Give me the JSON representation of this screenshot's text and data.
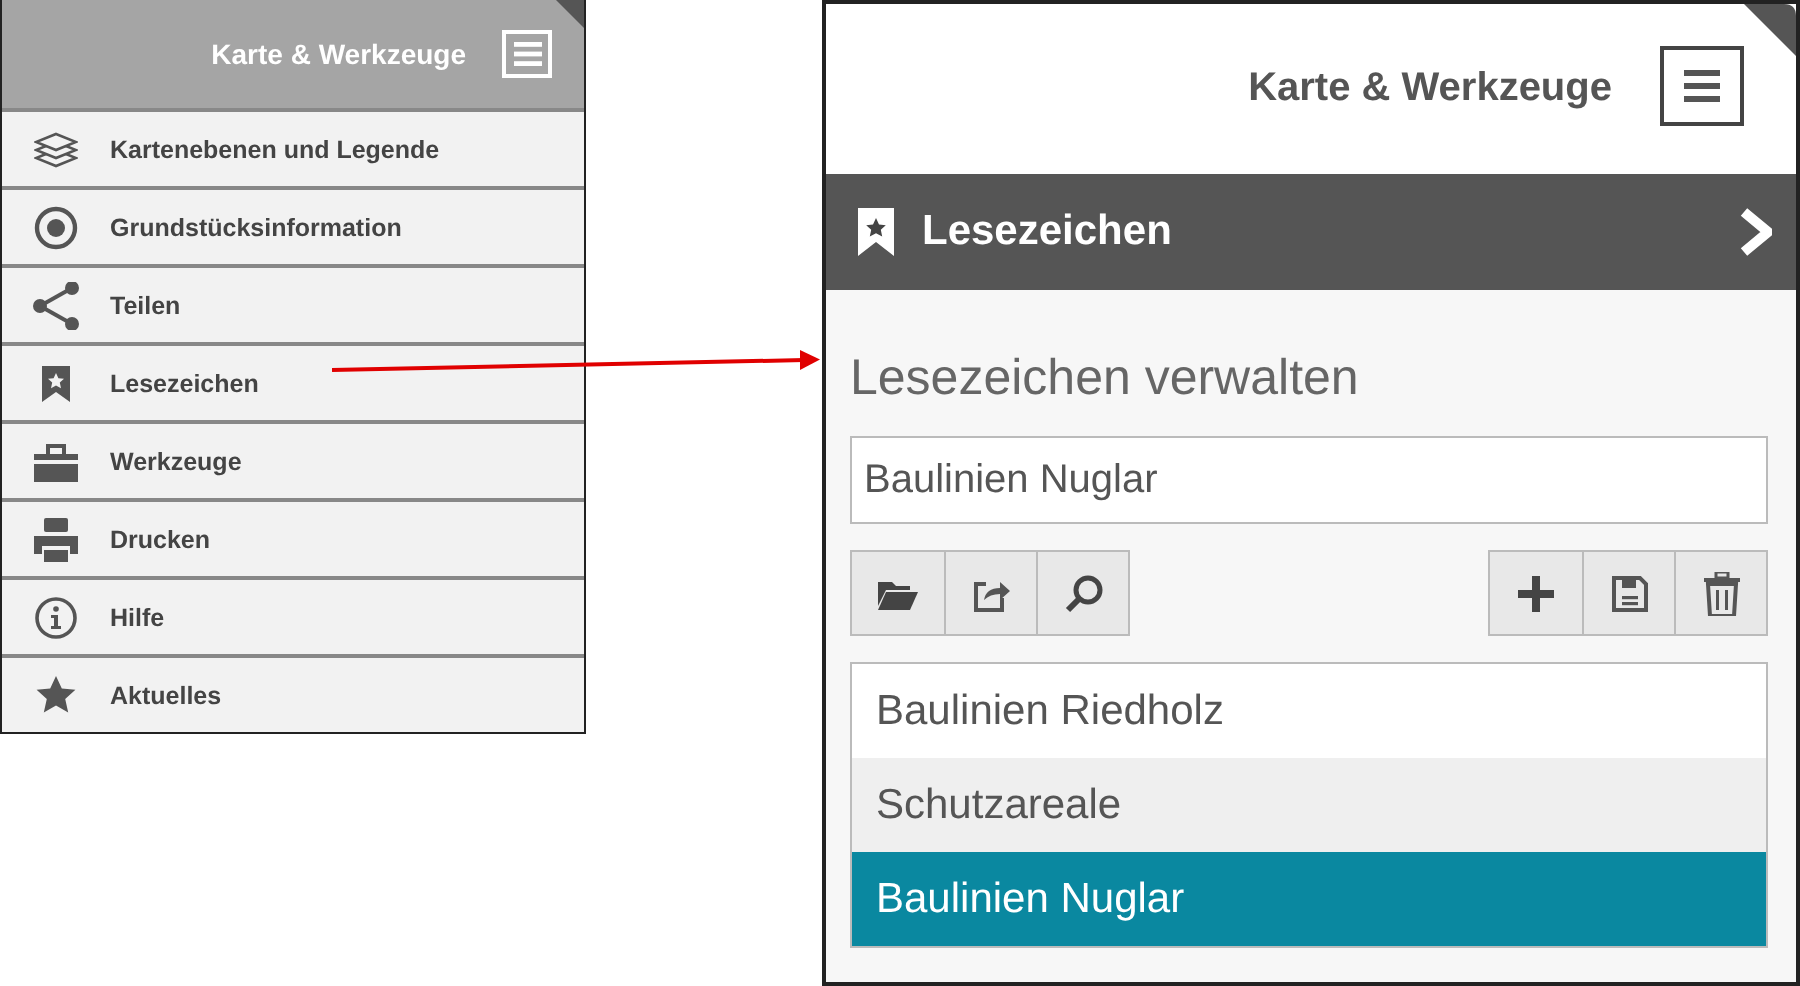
{
  "menu_panel": {
    "title": "Karte & Werkzeuge",
    "items": [
      {
        "label": "Kartenebenen und Legende"
      },
      {
        "label": "Grundstücksinformation"
      },
      {
        "label": "Teilen"
      },
      {
        "label": "Lesezeichen"
      },
      {
        "label": "Werkzeuge"
      },
      {
        "label": "Drucken"
      },
      {
        "label": "Hilfe"
      },
      {
        "label": "Aktuelles"
      }
    ]
  },
  "bookmark_panel": {
    "title": "Karte & Werkzeuge",
    "section_title": "Lesezeichen",
    "heading": "Lesezeichen verwalten",
    "name_field": {
      "value": "Baulinien Nuglar"
    },
    "bookmarks": [
      {
        "label": "Baulinien Riedholz",
        "selected": false,
        "highlighted": false
      },
      {
        "label": "Schutzareale",
        "selected": false,
        "highlighted": true
      },
      {
        "label": "Baulinien Nuglar",
        "selected": true,
        "highlighted": false
      }
    ]
  }
}
